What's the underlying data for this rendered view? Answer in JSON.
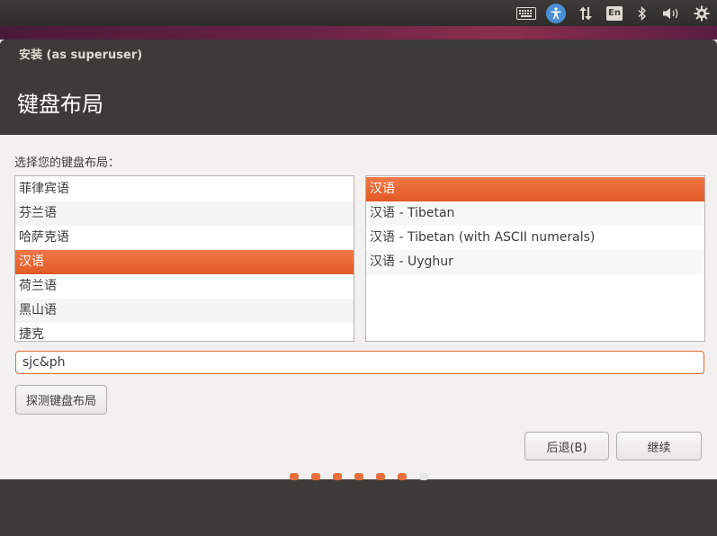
{
  "panel": {
    "indicators": [
      "keyboard-icon",
      "accessibility-icon",
      "network-icon",
      "language-indicator",
      "bluetooth-icon",
      "volume-icon",
      "settings-icon"
    ],
    "language_label": "En"
  },
  "window": {
    "title": "安装 (as superuser)",
    "page_title": "键盘布局"
  },
  "prompt": "选择您的键盘布局：",
  "layouts": {
    "items": [
      "菲律宾语",
      "芬兰语",
      "哈萨克语",
      "汉语",
      "荷兰语",
      "黑山语",
      "捷克"
    ],
    "selected": "汉语"
  },
  "variants": {
    "items": [
      "汉语",
      "汉语 - Tibetan",
      "汉语 - Tibetan (with ASCII numerals)",
      "汉语 - Uyghur"
    ],
    "selected": "汉语"
  },
  "test_input": {
    "value": "sjc&ph"
  },
  "buttons": {
    "detect": "探测键盘布局",
    "back": "后退(B)",
    "next": "继续"
  },
  "progress": {
    "total_steps": 7,
    "current_step": 7
  },
  "colors": {
    "accent": "#e95420",
    "header_bg": "#3c3b37",
    "window_bg": "#f2f1f0"
  }
}
